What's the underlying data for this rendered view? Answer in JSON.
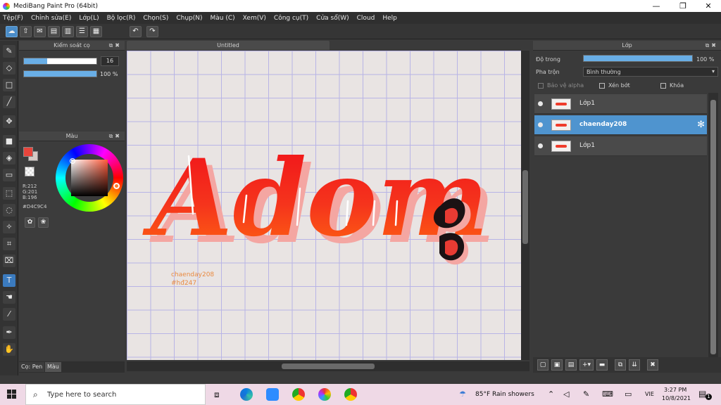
{
  "window": {
    "title": "MediBang Paint Pro (64bit)",
    "minimize": "—",
    "maximize": "❐",
    "close": "✕"
  },
  "menu": [
    "Tệp(F)",
    "Chỉnh sửa(E)",
    "Lớp(L)",
    "Bộ lọc(R)",
    "Chọn(S)",
    "Chụp(N)",
    "Màu (C)",
    "Xem(V)",
    "Công cụ(T)",
    "Cửa sổ(W)",
    "Cloud",
    "Help"
  ],
  "brush_panel": {
    "title": "Kiểm soát cọ",
    "size_value": "16",
    "size_fraction": 0.32,
    "opacity_label": "100 %",
    "opacity_fraction": 1.0
  },
  "color_panel": {
    "title": "Màu",
    "r": "R:212",
    "g": "G:201",
    "b": "B:196",
    "hex": "#D4C9C4",
    "primary_color": "#e8453c",
    "secondary_color": "#d4c9c4"
  },
  "bottom_tabs": {
    "brush": "Cọ: Pen",
    "color": "Màu"
  },
  "canvas": {
    "tab_title": "Untitled",
    "watermark_line1": "chaenday208",
    "watermark_line2": "#hđ247",
    "artwork_text": "Adom"
  },
  "layer_panel": {
    "title": "Lớp",
    "opacity_label": "Độ trong",
    "opacity_value": "100 %",
    "opacity_fraction": 1.0,
    "blend_label": "Pha trộn",
    "blend_value": "Bình thường",
    "protect_alpha": "Bảo vệ alpha",
    "clipping": "Xén bớt",
    "lock": "Khóa",
    "layers": [
      {
        "name": "Lớp1",
        "selected": false
      },
      {
        "name": "chaenday208",
        "selected": true
      },
      {
        "name": "Lớp1",
        "selected": false
      }
    ]
  },
  "taskbar": {
    "search_placeholder": "Type here to search",
    "weather": "85°F  Rain showers",
    "language": "VIE",
    "time": "3:27 PM",
    "date": "10/8/2021",
    "notifications": "1"
  }
}
